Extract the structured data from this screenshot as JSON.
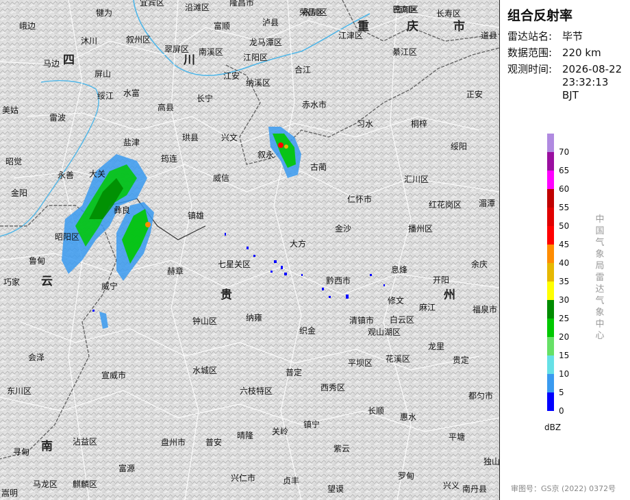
{
  "panel": {
    "title": "组合反射率",
    "station_label": "雷达站名:",
    "station_value": "毕节",
    "range_label": "数据范围:",
    "range_value": "220 km",
    "time_label": "观测时间:",
    "time_value": "2026-08-22 23:32:13 BJT",
    "unit": "dBZ",
    "agency_vertical": "中国气象局雷达气象中心",
    "approval": "审图号：GS京 (2022) 0372号"
  },
  "legend": [
    {
      "label": "70",
      "color": "#b08ae0"
    },
    {
      "label": "65",
      "color": "#9a0fa0"
    },
    {
      "label": "60",
      "color": "#ff00ff"
    },
    {
      "label": "55",
      "color": "#c00000"
    },
    {
      "label": "50",
      "color": "#e00000"
    },
    {
      "label": "45",
      "color": "#ff0000"
    },
    {
      "label": "40",
      "color": "#ff8c00"
    },
    {
      "label": "35",
      "color": "#e6b800"
    },
    {
      "label": "30",
      "color": "#ffff00"
    },
    {
      "label": "25",
      "color": "#008c00"
    },
    {
      "label": "20",
      "color": "#00c800"
    },
    {
      "label": "15",
      "color": "#66e066"
    },
    {
      "label": "10",
      "color": "#66e0e6"
    },
    {
      "label": "5",
      "color": "#3a9af0"
    },
    {
      "label": "0",
      "color": "#0000ff"
    }
  ],
  "map": {
    "places": [
      "犍为",
      "宜宾区",
      "沿滩区",
      "隆昌市",
      "荣昌区",
      "长寿区",
      "南川区",
      "巴南区",
      "峨边",
      "沐川",
      "叙州区",
      "翠屏区",
      "富顺",
      "泸县",
      "永川区",
      "江津区",
      "道县",
      "马边",
      "屏山",
      "南溪区",
      "龙马潭区",
      "江阳区",
      "合江",
      "綦江区",
      "水富",
      "绥江",
      "高县",
      "长宁",
      "江安",
      "纳溪区",
      "赤水市",
      "正安",
      "美姑",
      "雷波",
      "珙县",
      "兴文",
      "叙永",
      "习水",
      "桐梓",
      "绥阳",
      "盐津",
      "古蔺",
      "昭觉",
      "永善",
      "筠连",
      "威信",
      "汇川区",
      "金阳",
      "大关",
      "彝良",
      "镇雄",
      "仁怀市",
      "红花岗区",
      "湄潭",
      "昭阳区",
      "金沙",
      "播州区",
      "鲁甸",
      "大方",
      "七星关区",
      "余庆",
      "巧家",
      "赫章",
      "黔西市",
      "息烽",
      "开阳",
      "威宁",
      "修文",
      "福泉市",
      "钟山区",
      "纳雍",
      "清镇市",
      "白云区",
      "观山湖区",
      "麻江",
      "织金",
      "龙里",
      "贵定",
      "会泽",
      "平坝区",
      "花溪区",
      "宣威市",
      "水城区",
      "普定",
      "都匀市",
      "东川区",
      "六枝特区",
      "西秀区",
      "长顺",
      "惠水",
      "镇宁",
      "平塘",
      "关岭",
      "寻甸",
      "沾益区",
      "盘州市",
      "普安",
      "晴隆",
      "紫云",
      "罗甸",
      "富源",
      "独山",
      "兴仁市",
      "贞丰",
      "望谟",
      "马龙区",
      "麒麟区",
      "兴义",
      "南丹县",
      "嵩明"
    ],
    "provinces": [
      "四",
      "川",
      "重",
      "庆",
      "市",
      "贵",
      "州",
      "云",
      "南"
    ]
  }
}
